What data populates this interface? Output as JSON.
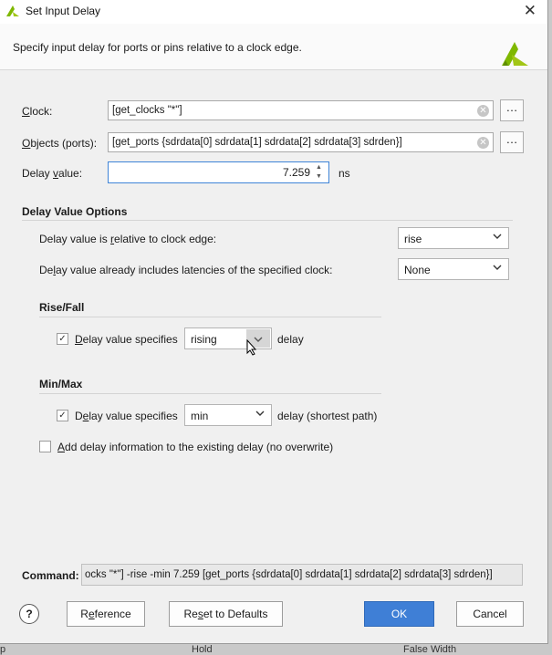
{
  "window": {
    "title": "Set Input Delay",
    "close_icon": "close-icon"
  },
  "header": {
    "description": "Specify input delay for ports or pins relative to a clock edge."
  },
  "clock": {
    "label": "Clock:",
    "value": "[get_clocks  \"*\"]"
  },
  "objects": {
    "label": "Objects (ports):",
    "value": "[get_ports {sdrdata[0] sdrdata[1] sdrdata[2] sdrdata[3] sdrden}]"
  },
  "delay": {
    "label": "Delay value:",
    "value": "7.259",
    "unit": "ns"
  },
  "delay_options": {
    "title": "Delay Value Options",
    "relative_label": "Delay value is relative to clock edge:",
    "relative_value": "rise",
    "latency_label": "Delay value already includes latencies of the specified clock:",
    "latency_value": "None"
  },
  "rise_fall": {
    "title": "Rise/Fall",
    "checkbox_label": "Delay value specifies",
    "checked": true,
    "value": "rising",
    "suffix": "delay"
  },
  "min_max": {
    "title": "Min/Max",
    "checkbox_label": "Delay value specifies",
    "checked": true,
    "value": "min",
    "suffix": "delay (shortest path)"
  },
  "add_delay": {
    "label": "Add delay information to the existing delay (no overwrite)",
    "checked": false
  },
  "command": {
    "label": "Command:",
    "value": "ocks  \"*\"] -rise -min 7.259 [get_ports {sdrdata[0] sdrdata[1] sdrdata[2] sdrdata[3] sdrden}]"
  },
  "buttons": {
    "help": "?",
    "reference": "Reference",
    "reset": "Reset to Defaults",
    "ok": "OK",
    "cancel": "Cancel"
  },
  "background_headers": {
    "left": "p",
    "middle": "Hold",
    "right": "False Width"
  },
  "colors": {
    "accent": "#3a7bd5",
    "ok_button": "#3f7fd6",
    "logo_green": "#7fb800"
  }
}
